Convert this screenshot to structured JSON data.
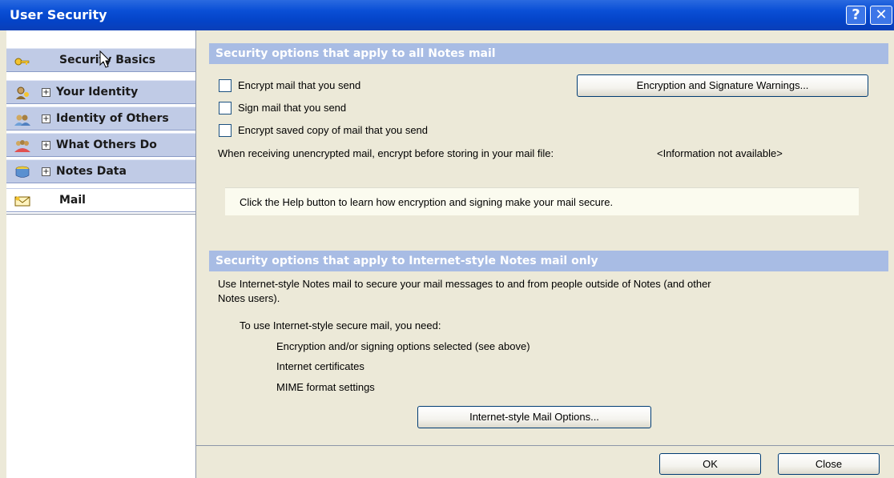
{
  "window": {
    "title": "User Security",
    "help_label": "?",
    "close_label": "✕"
  },
  "sidebar": {
    "items": [
      {
        "label": "Security Basics",
        "icon": "key-icon",
        "expand": ""
      },
      {
        "label": "Your Identity",
        "icon": "person-icon",
        "expand": "+"
      },
      {
        "label": "Identity of Others",
        "icon": "people-icon",
        "expand": "+"
      },
      {
        "label": "What Others Do",
        "icon": "group-icon",
        "expand": "+"
      },
      {
        "label": "Notes Data",
        "icon": "database-icon",
        "expand": "+"
      },
      {
        "label": "Mail",
        "icon": "mail-icon",
        "expand": ""
      }
    ]
  },
  "all_mail": {
    "header": "Security options that apply to all Notes mail",
    "encrypt_send": "Encrypt mail that you send",
    "sign_send": "Sign mail that you send",
    "encrypt_saved": "Encrypt saved copy of mail that you send",
    "warnings_button": "Encryption and Signature Warnings...",
    "receiving_text": "When receiving unencrypted mail, encrypt before storing in your mail file:",
    "receiving_value": "<Information not available>",
    "help_text": "Click the Help button to learn how encryption and signing make your mail secure."
  },
  "internet_mail": {
    "header": "Security options that apply to Internet-style Notes mail only",
    "intro_line1": "Use Internet-style Notes mail to secure your mail messages to and from people outside of Notes (and other",
    "intro_line2": "Notes users).",
    "need_text": "To use Internet-style secure mail, you need:",
    "req1": "Encryption and/or signing options selected (see above)",
    "req2": "Internet certificates",
    "req3": "MIME format settings",
    "options_button": "Internet-style Mail Options..."
  },
  "footer": {
    "ok": "OK",
    "close": "Close"
  }
}
